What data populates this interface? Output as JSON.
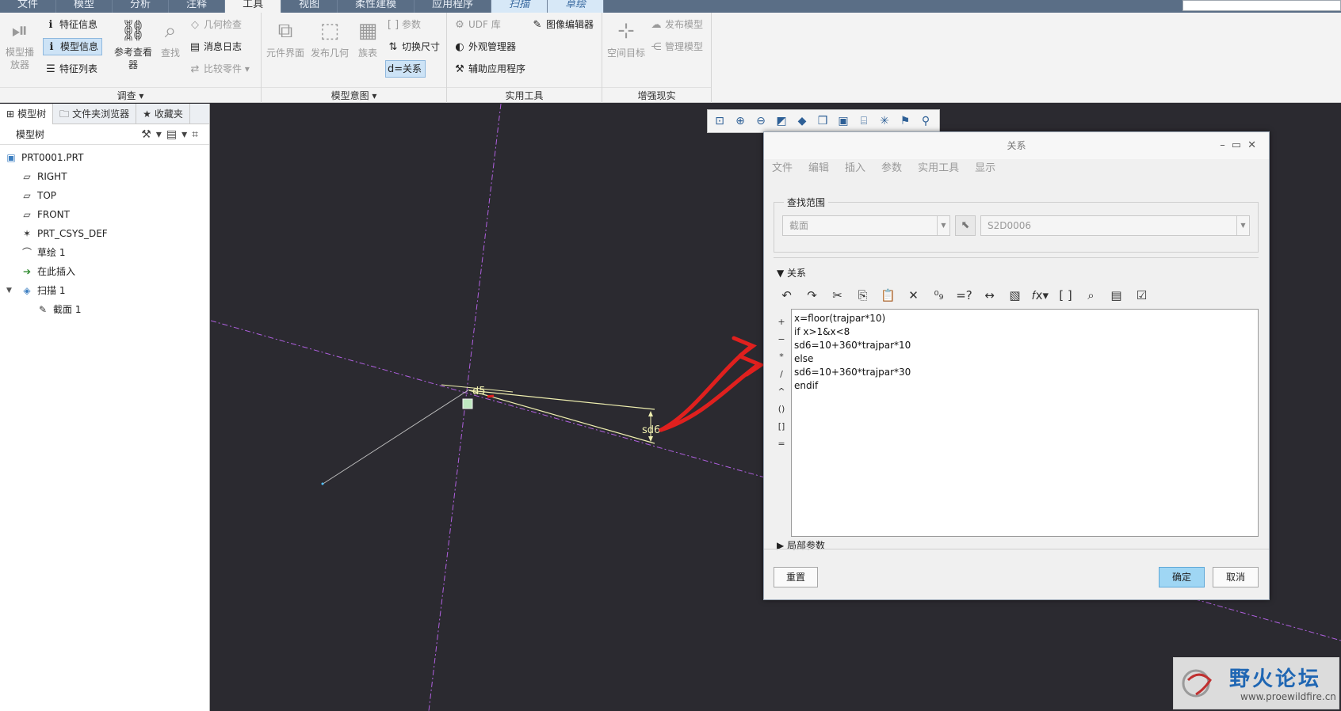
{
  "tabs": [
    {
      "label": "文件",
      "state": "normal"
    },
    {
      "label": "模型",
      "state": "normal"
    },
    {
      "label": "分析",
      "state": "normal"
    },
    {
      "label": "注释",
      "state": "normal"
    },
    {
      "label": "工具",
      "state": "active"
    },
    {
      "label": "视图",
      "state": "normal"
    },
    {
      "label": "柔性建模",
      "state": "normal"
    },
    {
      "label": "应用程序",
      "state": "normal"
    },
    {
      "label": "扫描",
      "state": "ctx"
    },
    {
      "label": "草绘",
      "state": "ctx"
    }
  ],
  "ribbon": {
    "investigate": {
      "label": "调查",
      "model_player": "模型播放器",
      "feature_info": "特征信息",
      "model_info": "模型信息",
      "feature_list": "特征列表",
      "reference_viewer": "参考查看器",
      "find": "查找",
      "geometry_check": "几何检查",
      "message_log": "消息日志",
      "compare_part": "比较零件"
    },
    "model_intent": {
      "label": "模型意图",
      "component_interface": "元件界面",
      "publish_geometry": "发布几何",
      "family_table": "族表",
      "parameters": "参数",
      "switch_dimensions": "切换尺寸",
      "relations": "关系"
    },
    "utilities": {
      "label": "实用工具",
      "udf_library": "UDF 库",
      "appearance_manager": "外观管理器",
      "aux_applications": "辅助应用程序",
      "image_editor": "图像编辑器"
    },
    "ar": {
      "label": "增强现实",
      "spatial_target": "空间目标",
      "publish_model": "发布模型",
      "manage_models": "管理模型"
    }
  },
  "left_panel": {
    "tabs": [
      "模型树",
      "文件夹浏览器",
      "收藏夹"
    ],
    "header": "模型树",
    "tree": [
      {
        "label": "PRT0001.PRT",
        "icon": "part-icon",
        "indent": 0
      },
      {
        "label": "RIGHT",
        "icon": "datum-plane-icon",
        "indent": 1
      },
      {
        "label": "TOP",
        "icon": "datum-plane-icon",
        "indent": 1
      },
      {
        "label": "FRONT",
        "icon": "datum-plane-icon",
        "indent": 1
      },
      {
        "label": "PRT_CSYS_DEF",
        "icon": "csys-icon",
        "indent": 1
      },
      {
        "label": "草绘 1",
        "icon": "sketch-icon",
        "indent": 1
      },
      {
        "label": "在此插入",
        "icon": "insert-here-icon",
        "indent": 1
      },
      {
        "label": "扫描 1",
        "icon": "sweep-icon",
        "indent": 1
      },
      {
        "label": "截面 1",
        "icon": "section-icon",
        "indent": 2
      }
    ]
  },
  "graphics": {
    "dim_d5": "d5",
    "dim_sd6": "sd6"
  },
  "dialog": {
    "title": "关系",
    "menu": [
      "文件",
      "编辑",
      "插入",
      "参数",
      "实用工具",
      "显示"
    ],
    "scope_label": "查找范围",
    "scope_type": "截面",
    "scope_object": "S2D0006",
    "relations_heading": "关系",
    "side_ops": [
      "+",
      "−",
      "*",
      "/",
      "^",
      "()",
      "[]",
      "="
    ],
    "code": [
      "x=floor(trajpar*10)",
      "if x>1&x<8",
      "sd6=10+360*trajpar*10",
      "else",
      "sd6=10+360*trajpar*30",
      "endif"
    ],
    "local_params": "局部参数",
    "reset": "重置",
    "ok": "确定",
    "cancel": "取消"
  },
  "watermark": {
    "title": "野火论坛",
    "url": "www.proewildfire.cn"
  },
  "colors": {
    "background": "#2b2a30",
    "datum_line": "#b060e0",
    "dimension": "#f0f0b0",
    "annotation_arrow": "#e0201e",
    "primary_button": "#9fd6f4"
  }
}
